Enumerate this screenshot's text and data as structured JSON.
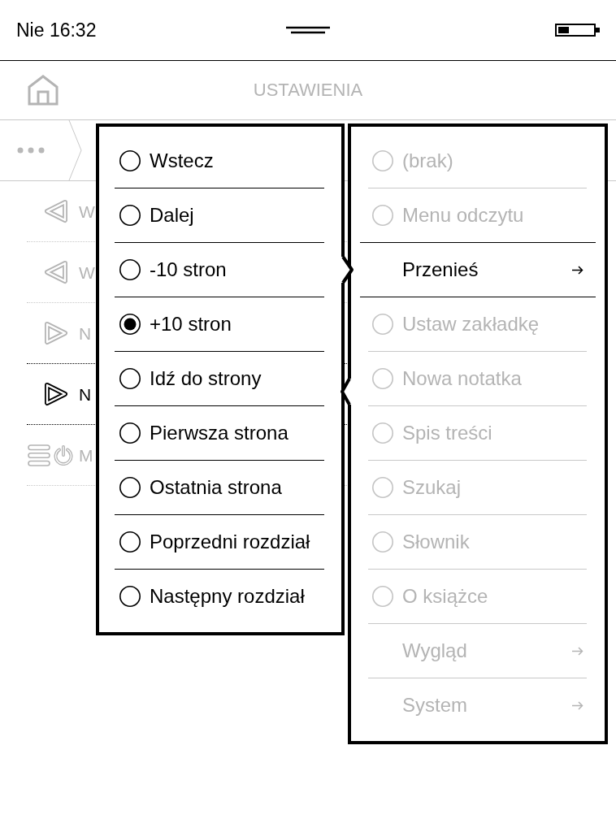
{
  "status_bar": {
    "clock": "Nie 16:32"
  },
  "header": {
    "title": "USTAWIENIA"
  },
  "list": {
    "rows": [
      {
        "kind": "previous",
        "label": "W",
        "selected": false
      },
      {
        "kind": "previous",
        "label": "W",
        "selected": false
      },
      {
        "kind": "next",
        "label": "N",
        "selected": false
      },
      {
        "kind": "next",
        "label": "N",
        "selected": true
      },
      {
        "kind": "menu",
        "label": "M",
        "selected": false
      }
    ]
  },
  "submenu": {
    "items": [
      {
        "label": "Wstecz",
        "selected": false
      },
      {
        "label": "Dalej",
        "selected": false
      },
      {
        "label": "-10 stron",
        "selected": false
      },
      {
        "label": "+10 stron",
        "selected": true
      },
      {
        "label": "Idź do strony",
        "selected": false
      },
      {
        "label": "Pierwsza strona",
        "selected": false
      },
      {
        "label": "Ostatnia strona",
        "selected": false
      },
      {
        "label": "Poprzedni rozdział",
        "selected": false
      },
      {
        "label": "Następny rozdział",
        "selected": false
      }
    ]
  },
  "action_menu": {
    "items": [
      {
        "kind": "radio",
        "label": "(brak)",
        "selected": false,
        "checked": false
      },
      {
        "kind": "radio",
        "label": "Menu odczytu",
        "selected": false,
        "checked": false
      },
      {
        "kind": "submenu",
        "label": "Przenieś",
        "selected": true
      },
      {
        "kind": "radio",
        "label": "Ustaw zakładkę",
        "selected": false,
        "checked": false
      },
      {
        "kind": "radio",
        "label": "Nowa notatka",
        "selected": false,
        "checked": false
      },
      {
        "kind": "radio",
        "label": "Spis treści",
        "selected": false,
        "checked": false
      },
      {
        "kind": "radio",
        "label": "Szukaj",
        "selected": false,
        "checked": false
      },
      {
        "kind": "radio",
        "label": "Słownik",
        "selected": false,
        "checked": false
      },
      {
        "kind": "radio",
        "label": "O książce",
        "selected": false,
        "checked": false
      },
      {
        "kind": "submenu",
        "label": "Wygląd",
        "selected": false
      },
      {
        "kind": "submenu",
        "label": "System",
        "selected": false
      }
    ]
  }
}
